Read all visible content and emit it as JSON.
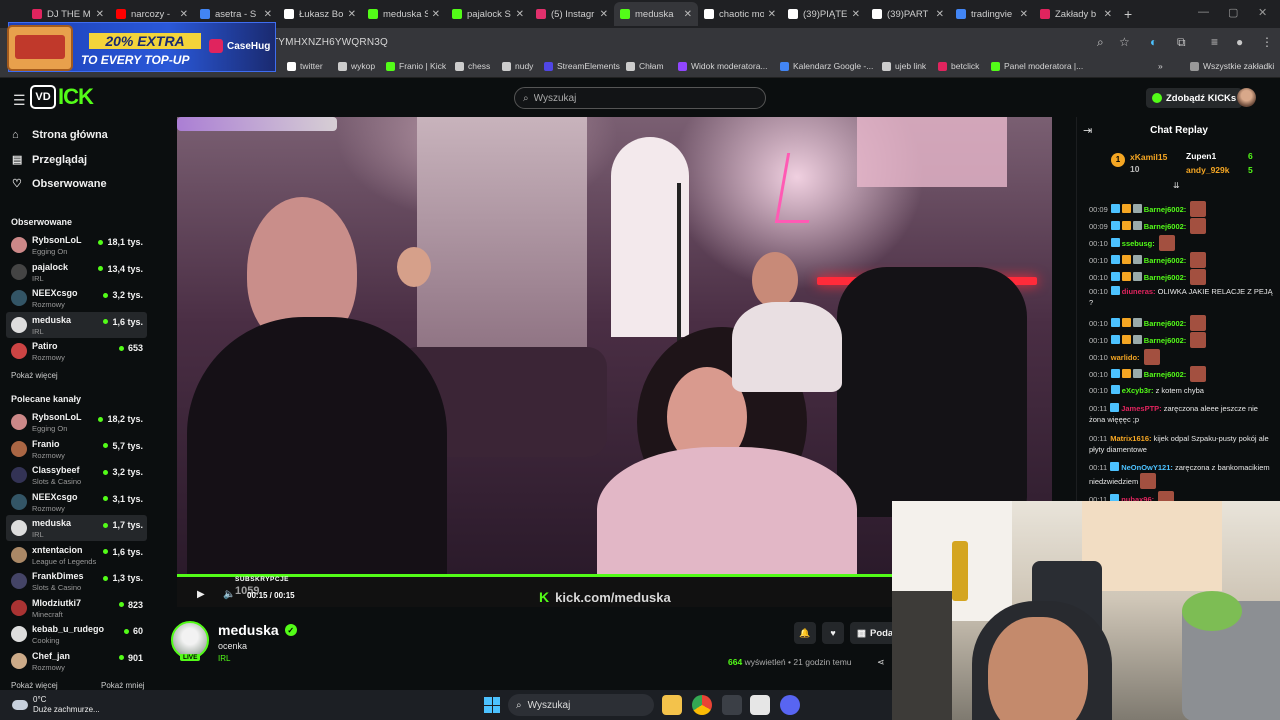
{
  "browser": {
    "tabs": [
      {
        "label": "DJ THE M",
        "color": "#e0245e"
      },
      {
        "label": "narcozy -",
        "color": "#ff0000"
      },
      {
        "label": "asetra - S",
        "color": "#4285f4"
      },
      {
        "label": "Łukasz Bo",
        "color": "#ffffff"
      },
      {
        "label": "meduska S",
        "color": "#53fc18"
      },
      {
        "label": "pajalock S",
        "color": "#53fc18"
      },
      {
        "label": "(5) Instagr",
        "color": "#e1306c"
      },
      {
        "label": "meduska",
        "color": "#53fc18",
        "active": true
      },
      {
        "label": "chaotic mo",
        "color": "#ffffff"
      },
      {
        "label": "(39)PIĄTE",
        "color": "#ffffff"
      },
      {
        "label": "(39)PART",
        "color": "#ffffff"
      },
      {
        "label": "tradingvie",
        "color": "#4285f4"
      },
      {
        "label": "Zakłady b",
        "color": "#e0245e"
      }
    ],
    "new_tab": "+",
    "url": "TYMHXNZH6YWQRN3Q",
    "bookmarks": [
      {
        "label": "twitter",
        "color": "#ffffff"
      },
      {
        "label": "wykop",
        "color": "#cccccc"
      },
      {
        "label": "Franio | Kick",
        "color": "#53fc18"
      },
      {
        "label": "chess",
        "color": "#cccccc"
      },
      {
        "label": "nudy",
        "color": "#cccccc"
      },
      {
        "label": "StreamElements",
        "color": "#5046e5"
      },
      {
        "label": "Chłam",
        "color": "#cccccc"
      },
      {
        "label": "Widok moderatora...",
        "color": "#9146ff"
      },
      {
        "label": "Kalendarz Google -...",
        "color": "#4285f4"
      },
      {
        "label": "ujeb link",
        "color": "#cccccc"
      },
      {
        "label": "betclick",
        "color": "#e0245e"
      },
      {
        "label": "Panel moderatora |...",
        "color": "#53fc18"
      }
    ],
    "more_bookmarks": "»",
    "all_bookmarks": "Wszystkie zakładki"
  },
  "ad": {
    "promo_line1": "20% EXTRA",
    "promo_line2": "TO EVERY TOP-UP",
    "brand": "CaseHug"
  },
  "header": {
    "logo_text": "ICK",
    "search_placeholder": "Wyszukaj",
    "get_kicks": "Zdobądź KICKs"
  },
  "sidebar": {
    "nav": [
      {
        "label": "Strona główna",
        "icon": "home-icon"
      },
      {
        "label": "Przeglądaj",
        "icon": "browse-icon"
      },
      {
        "label": "Obserwowane",
        "icon": "heart-icon"
      }
    ],
    "following_header": "Obserwowane",
    "following": [
      {
        "name": "RybsonLoL",
        "category": "Egging On",
        "viewers": "18,1 tys.",
        "color": "#c88"
      },
      {
        "name": "pajalock",
        "category": "IRL",
        "viewers": "13,4 tys.",
        "color": "#444"
      },
      {
        "name": "NEEXcsgo",
        "category": "Rozmowy",
        "viewers": "3,2 tys.",
        "color": "#356"
      },
      {
        "name": "meduska",
        "category": "IRL",
        "viewers": "1,6 tys.",
        "color": "#ddd",
        "selected": true
      },
      {
        "name": "Patiro",
        "category": "Rozmowy",
        "viewers": "653",
        "color": "#c44"
      }
    ],
    "show_more": "Pokaż więcej",
    "recommended_header": "Polecane kanały",
    "recommended": [
      {
        "name": "RybsonLoL",
        "category": "Egging On",
        "viewers": "18,2 tys.",
        "color": "#c88"
      },
      {
        "name": "Franio",
        "category": "Rozmowy",
        "viewers": "5,7 tys.",
        "color": "#a64"
      },
      {
        "name": "Classybeef",
        "category": "Slots & Casino",
        "viewers": "3,2 tys.",
        "color": "#335"
      },
      {
        "name": "NEEXcsgo",
        "category": "Rozmowy",
        "viewers": "3,1 tys.",
        "color": "#356"
      },
      {
        "name": "meduska",
        "category": "IRL",
        "viewers": "1,7 tys.",
        "color": "#ddd",
        "selected": true
      },
      {
        "name": "xntentacion",
        "category": "League of Legends",
        "viewers": "1,6 tys.",
        "color": "#a86"
      },
      {
        "name": "FrankDimes",
        "category": "Slots & Casino",
        "viewers": "1,3 tys.",
        "color": "#446"
      },
      {
        "name": "Mlodziutki7",
        "category": "Minecraft",
        "viewers": "823",
        "color": "#a33"
      },
      {
        "name": "kebab_u_rudego",
        "category": "Cooking",
        "viewers": "60",
        "color": "#ddd"
      },
      {
        "name": "Chef_jan",
        "category": "Rozmowy",
        "viewers": "901",
        "color": "#ca8"
      }
    ],
    "show_more_2": "Pokaż więcej",
    "show_less": "Pokaż mniej"
  },
  "player": {
    "progress": 1.0,
    "time": "00:15 / 00:15",
    "subs_label": "SUBSKRYPCJE",
    "subs_count": "1059",
    "watermark": "kick.com/meduska"
  },
  "channel": {
    "name": "meduska",
    "title": "ocenka",
    "category": "IRL",
    "live_badge": "LIVE",
    "share_label": "Poda",
    "views_count": "664",
    "views_label": "wyświetleń",
    "ago": "21 godzin temu"
  },
  "chat": {
    "title": "Chat Replay",
    "leaders": [
      {
        "rank": "1",
        "name": "xKamil15",
        "score": "10"
      },
      {
        "name": "Zupen1",
        "score": "6"
      },
      {
        "name": "andy_929k",
        "score": "5"
      }
    ],
    "messages": [
      {
        "time": "00:09",
        "user": "Barnej6002:",
        "text": "",
        "color": "#53fc18",
        "badges": 3,
        "emote": true
      },
      {
        "time": "00:09",
        "user": "Barnej6002:",
        "text": "",
        "color": "#53fc18",
        "badges": 3,
        "emote": true
      },
      {
        "time": "00:10",
        "user": "ssebusg:",
        "text": "",
        "color": "#53fc18",
        "badges": 1,
        "emote": true
      },
      {
        "time": "00:10",
        "user": "Barnej6002:",
        "text": "",
        "color": "#53fc18",
        "badges": 3,
        "emote": true
      },
      {
        "time": "00:10",
        "user": "Barnej6002:",
        "text": "",
        "color": "#53fc18",
        "badges": 3,
        "emote": true
      },
      {
        "time": "00:10",
        "user": "diuneras:",
        "text": "OLIWKA JAKIE RELACJE Z PEJĄ ?",
        "color": "#e0245e",
        "badges": 1,
        "emote": false
      },
      {
        "time": "00:10",
        "user": "Barnej6002:",
        "text": "",
        "color": "#53fc18",
        "badges": 3,
        "emote": true
      },
      {
        "time": "00:10",
        "user": "Barnej6002:",
        "text": "",
        "color": "#53fc18",
        "badges": 3,
        "emote": true
      },
      {
        "time": "00:10",
        "user": "warlido:",
        "text": "",
        "color": "#f5a623",
        "badges": 0,
        "emote": true
      },
      {
        "time": "00:10",
        "user": "Barnej6002:",
        "text": "",
        "color": "#53fc18",
        "badges": 3,
        "emote": true
      },
      {
        "time": "00:10",
        "user": "eXcyb3r:",
        "text": "z kotem chyba",
        "color": "#53fc18",
        "badges": 1,
        "emote": false
      },
      {
        "time": "00:11",
        "user": "JamesPTP:",
        "text": "zaręczona aleee jeszcze nie żona więęęc ;p",
        "color": "#e0245e",
        "badges": 1,
        "emote": false
      },
      {
        "time": "00:11",
        "user": "Matrix1616:",
        "text": "kijek odpal Szpaku-pusty pokój ale płyty diamentowe",
        "color": "#f5a623",
        "badges": 0,
        "emote": false
      },
      {
        "time": "00:11",
        "user": "NeOnOwY121:",
        "text": "zaręczona z bankomacikiem niedzwiedziem",
        "color": "#4cc2ff",
        "badges": 1,
        "emote": true
      },
      {
        "time": "00:11",
        "user": "nubax96:",
        "text": "",
        "color": "#e0245e",
        "badges": 1,
        "emote": true
      }
    ]
  },
  "taskbar": {
    "temp": "0°C",
    "weather": "Duże zachmurze...",
    "search": "Wyszukaj"
  },
  "colors": {
    "kick_green": "#53fc18",
    "bg": "#0b0e0f"
  }
}
